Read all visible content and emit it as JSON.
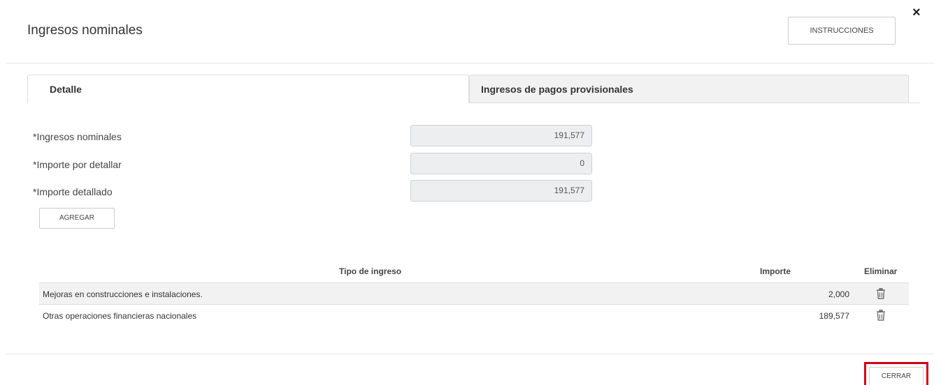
{
  "header": {
    "title": "Ingresos nominales",
    "instructions_label": "INSTRUCCIONES",
    "close_glyph": "×"
  },
  "tabs": [
    {
      "label": "Detalle",
      "active": true
    },
    {
      "label": "Ingresos de pagos provisionales",
      "active": false
    }
  ],
  "fields": [
    {
      "label": "*Ingresos nominales",
      "value": "191,577"
    },
    {
      "label": "*Importe por detallar",
      "value": "0"
    },
    {
      "label": "*Importe detallado",
      "value": "191,577"
    }
  ],
  "add_button_label": "AGREGAR",
  "table": {
    "headers": {
      "tipo": "Tipo de ingreso",
      "importe": "Importe",
      "eliminar": "Eliminar"
    },
    "rows": [
      {
        "tipo": "Mejoras en construcciones e instalaciones.",
        "importe": "2,000"
      },
      {
        "tipo": "Otras operaciones financieras nacionales",
        "importe": "189,577"
      }
    ]
  },
  "footer": {
    "close_label": "CERRAR"
  },
  "colors": {
    "highlight": "#d0021b",
    "readonly_field": "#eceeef",
    "inactive_tab": "#f2f2f2"
  }
}
